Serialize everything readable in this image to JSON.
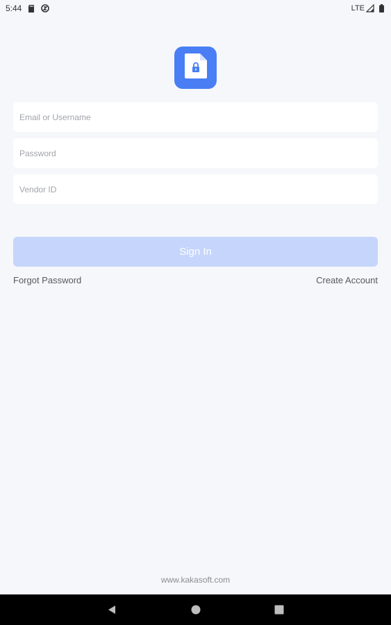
{
  "status_bar": {
    "time": "5:44",
    "network": "LTE",
    "icons": [
      "sd-card-icon",
      "sync-icon",
      "signal-icon",
      "battery-icon"
    ]
  },
  "logo": {
    "icon": "locked-document-icon",
    "color": "#4a7ef5"
  },
  "form": {
    "email_placeholder": "Email or Username",
    "password_placeholder": "Password",
    "vendor_placeholder": "Vendor ID",
    "signin_label": "Sign In",
    "signin_color": "#c5d5fb"
  },
  "links": {
    "forgot_password": "Forgot Password",
    "create_account": "Create Account"
  },
  "footer": {
    "url": "www.kakasoft.com"
  },
  "nav_bar": {
    "icons": [
      "back-icon",
      "home-icon",
      "recents-icon"
    ]
  }
}
